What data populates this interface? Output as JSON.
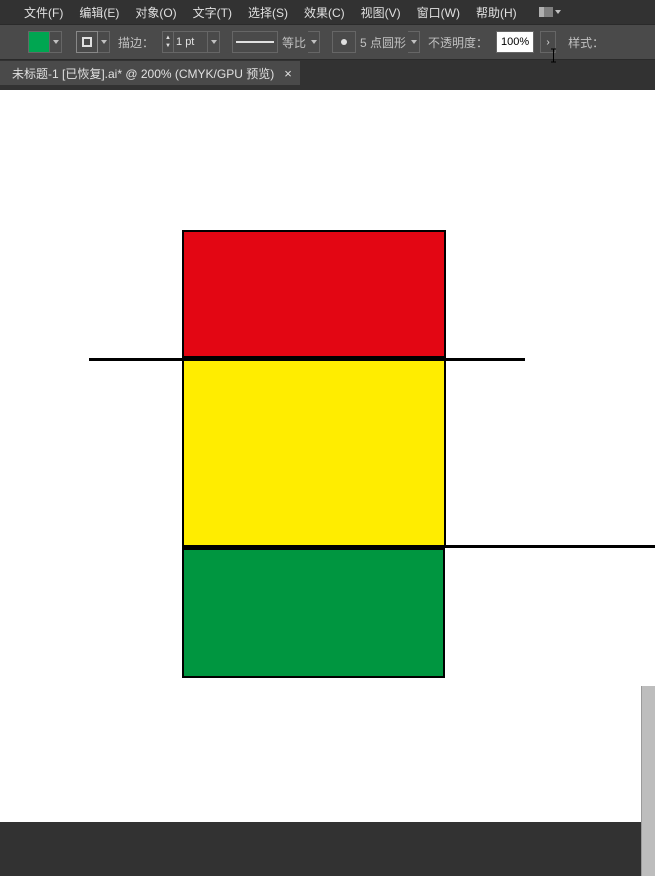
{
  "menu": {
    "file": "文件(F)",
    "edit": "编辑(E)",
    "object": "对象(O)",
    "type": "文字(T)",
    "select": "选择(S)",
    "effect": "效果(C)",
    "view": "视图(V)",
    "window": "窗口(W)",
    "help": "帮助(H)"
  },
  "toolbar": {
    "stroke_label": "描边：",
    "stroke_value": "1 pt",
    "profile_label": "等比",
    "brush_label": "5 点圆形",
    "opacity_label": "不透明度：",
    "opacity_value": "100%",
    "style_label": "样式：",
    "fill_color": "#00a651"
  },
  "document": {
    "tab_title": "未标题-1  [已恢复].ai* @ 200% (CMYK/GPU 预览)"
  },
  "artwork": {
    "colors": {
      "red": "#e30613",
      "yellow": "#ffed00",
      "green": "#009640"
    }
  }
}
